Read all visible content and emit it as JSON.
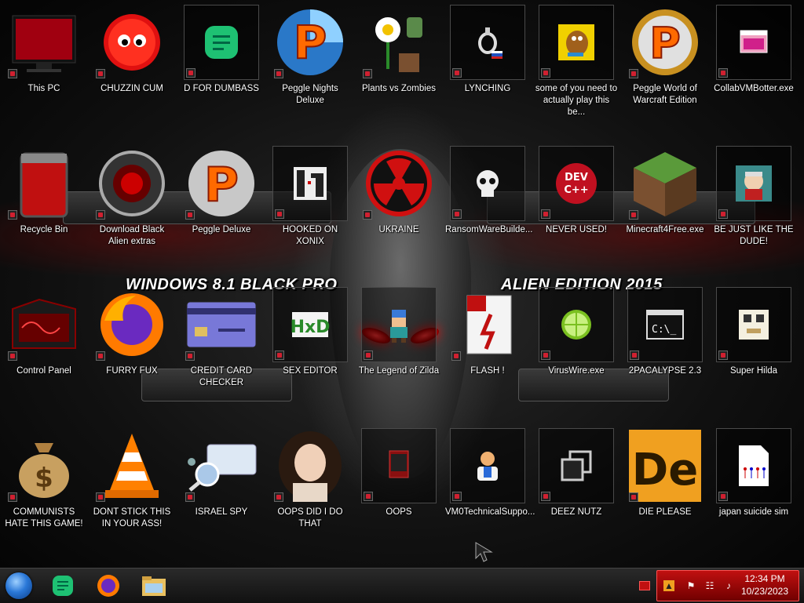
{
  "wallpaper": {
    "banner_left": "WINDOWS 8.1 BLACK PRO",
    "banner_right": "ALIEN EDITION 2015"
  },
  "desktop": {
    "icons": [
      {
        "label": "This PC",
        "icon": "computer-icon"
      },
      {
        "label": "CHUZZIN CUM",
        "icon": "chuzzle-icon"
      },
      {
        "label": "D FOR DUMBASS",
        "icon": "chat-app-icon"
      },
      {
        "label": "Peggle Nights Deluxe",
        "icon": "peggle-icon"
      },
      {
        "label": "Plants vs Zombies",
        "icon": "plants-vs-zombies-icon"
      },
      {
        "label": "LYNCHING",
        "icon": "noose-icon"
      },
      {
        "label": "some of you need to actually play this be...",
        "icon": "scooby-icon"
      },
      {
        "label": "Peggle World of Warcraft Edition",
        "icon": "peggle-icon"
      },
      {
        "label": "CollabVMBotter.exe",
        "icon": "app-window-icon"
      },
      {
        "label": "Recycle Bin",
        "icon": "recycle-bin-icon"
      },
      {
        "label": "Download Black Alien extras",
        "icon": "alien-extras-icon"
      },
      {
        "label": "Peggle Deluxe",
        "icon": "peggle-icon"
      },
      {
        "label": "HOOKED ON XONIX",
        "icon": "xonix-icon"
      },
      {
        "label": "UKRAINE",
        "icon": "radiation-icon"
      },
      {
        "label": "RansomWareBuilde...",
        "icon": "skull-icon"
      },
      {
        "label": "NEVER USED!",
        "icon": "dev-cpp-icon"
      },
      {
        "label": "Minecraft4Free.exe",
        "icon": "grass-block-icon"
      },
      {
        "label": "BE JUST LIKE THE DUDE!",
        "icon": "dude-icon"
      },
      {
        "label": "Control Panel",
        "icon": "control-panel-icon"
      },
      {
        "label": "FURRY FUX",
        "icon": "firefox-icon"
      },
      {
        "label": "CREDIT CARD CHECKER",
        "icon": "credit-card-icon"
      },
      {
        "label": "SEX EDITOR",
        "icon": "hxd-icon"
      },
      {
        "label": "The Legend of Zilda",
        "icon": "pixel-hero-icon"
      },
      {
        "label": "FLASH !",
        "icon": "flash-icon"
      },
      {
        "label": "VirusWire.exe",
        "icon": "lime-icon"
      },
      {
        "label": "2PACALYPSE 2.3",
        "icon": "terminal-icon"
      },
      {
        "label": "Super Hilda",
        "icon": "pixel-cat-icon"
      },
      {
        "label": "COMMUNISTS HATE THIS GAME!",
        "icon": "money-bag-icon"
      },
      {
        "label": "DONT STICK THIS IN YOUR ASS!",
        "icon": "vlc-cone-icon"
      },
      {
        "label": "ISRAEL SPY",
        "icon": "magnifier-icon"
      },
      {
        "label": "OOPS DID I DO THAT",
        "icon": "portrait-icon"
      },
      {
        "label": "OOPS",
        "icon": "book-icon"
      },
      {
        "label": "VM0TechnicalSuppo...",
        "icon": "tech-support-icon"
      },
      {
        "label": "DEEZ NUTZ",
        "icon": "windows-stack-icon"
      },
      {
        "label": "DIE PLEASE",
        "icon": "de-icon"
      },
      {
        "label": "japan suicide sim",
        "icon": "document-icon"
      }
    ]
  },
  "taskbar": {
    "pinned": [
      {
        "name": "start-button",
        "icon": "start-orb-icon"
      },
      {
        "name": "chat-app",
        "icon": "chat-app-icon"
      },
      {
        "name": "firefox",
        "icon": "firefox-icon"
      },
      {
        "name": "file-explorer",
        "icon": "folder-icon"
      }
    ],
    "tray": {
      "time": "12:34 PM",
      "date": "10/23/2023"
    }
  },
  "colors": {
    "accent_red": "#d02030",
    "tray_red": "#b01010",
    "start_blue": "#2a78d8"
  }
}
